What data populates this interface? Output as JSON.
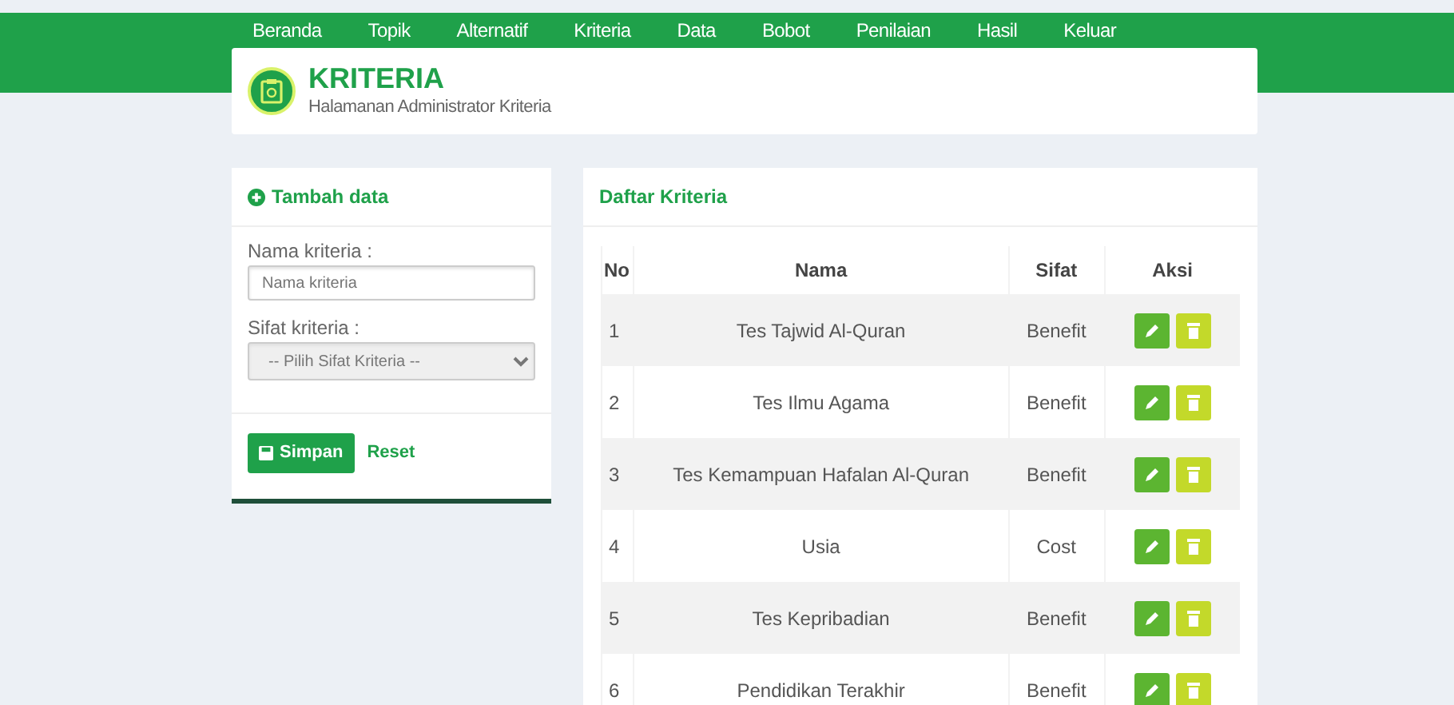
{
  "nav": {
    "items": [
      "Beranda",
      "Topik",
      "Alternatif",
      "Kriteria",
      "Data",
      "Bobot",
      "Penilaian",
      "Hasil",
      "Keluar"
    ]
  },
  "header": {
    "title": "KRITERIA",
    "subtitle": "Halamanan Administrator Kriteria"
  },
  "form": {
    "title": "Tambah data",
    "fields": [
      {
        "kind": "input",
        "label": "Nama kriteria :",
        "placeholder": "Nama kriteria"
      },
      {
        "kind": "select",
        "label": "Sifat kriteria :",
        "value": "-- Pilih Sifat Kriteria --"
      }
    ],
    "save": "Simpan",
    "reset": "Reset"
  },
  "table": {
    "title": "Daftar Kriteria",
    "columns": [
      "No",
      "Nama",
      "Sifat",
      "Aksi"
    ],
    "rows": [
      {
        "no": "1",
        "nama": "Tes Tajwid Al-Quran",
        "sifat": "Benefit"
      },
      {
        "no": "2",
        "nama": "Tes Ilmu Agama",
        "sifat": "Benefit"
      },
      {
        "no": "3",
        "nama": "Tes Kemampuan Hafalan Al-Quran",
        "sifat": "Benefit"
      },
      {
        "no": "4",
        "nama": "Usia",
        "sifat": "Cost"
      },
      {
        "no": "5",
        "nama": "Tes Kepribadian",
        "sifat": "Benefit"
      },
      {
        "no": "6",
        "nama": "Pendidikan Terakhir",
        "sifat": "Benefit"
      }
    ]
  }
}
